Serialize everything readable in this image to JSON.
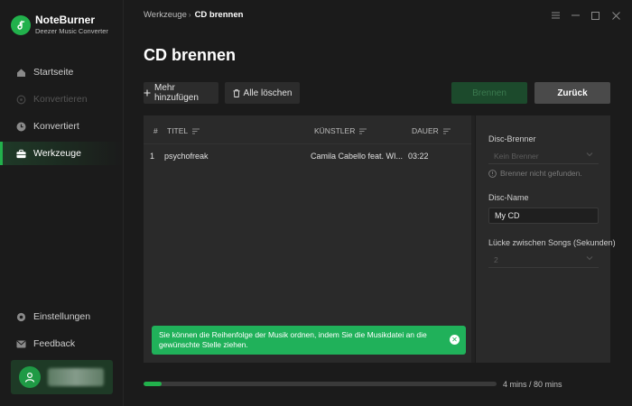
{
  "app": {
    "name": "NoteBurner",
    "subtitle": "Deezer Music Converter"
  },
  "sidebar": {
    "items": [
      {
        "label": "Startseite",
        "icon": "home-icon",
        "state": "normal"
      },
      {
        "label": "Konvertieren",
        "icon": "convert-icon",
        "state": "disabled"
      },
      {
        "label": "Konvertiert",
        "icon": "clock-icon",
        "state": "normal"
      },
      {
        "label": "Werkzeuge",
        "icon": "toolbox-icon",
        "state": "active"
      }
    ],
    "bottom_items": [
      {
        "label": "Einstellungen",
        "icon": "gear-icon"
      },
      {
        "label": "Feedback",
        "icon": "mail-icon"
      }
    ]
  },
  "breadcrumb": {
    "parent": "Werkzeuge",
    "separator": "›",
    "current": "CD brennen"
  },
  "page": {
    "title": "CD brennen"
  },
  "toolbar": {
    "add_more": "Mehr hinzufügen",
    "clear_all": "Alle löschen",
    "burn": "Brennen",
    "back": "Zurück"
  },
  "table": {
    "columns": {
      "index": "#",
      "title": "TITEL",
      "artist": "KÜNSTLER",
      "duration": "DAUER"
    },
    "rows": [
      {
        "index": "1",
        "title": "psychofreak",
        "artist": "Camila Cabello feat. WI...",
        "duration": "03:22"
      }
    ]
  },
  "toast": {
    "message": "Sie können die Reihenfolge der Musik ordnen, indem Sie die Musikdatei an die gewünschte Stelle ziehen."
  },
  "settings": {
    "burner_label": "Disc-Brenner",
    "burner_value": "Kein Brenner",
    "burner_note": "Brenner nicht gefunden.",
    "disc_name_label": "Disc-Name",
    "disc_name_value": "My CD",
    "gap_label": "Lücke zwischen Songs (Sekunden)",
    "gap_value": "2"
  },
  "progress": {
    "used_minutes": 4,
    "total_minutes": 80,
    "text": "4 mins / 80 mins"
  },
  "colors": {
    "accent": "#22b14c",
    "toast": "#20b15a",
    "background": "#1b1b1b",
    "panel": "#2a2a2a"
  }
}
